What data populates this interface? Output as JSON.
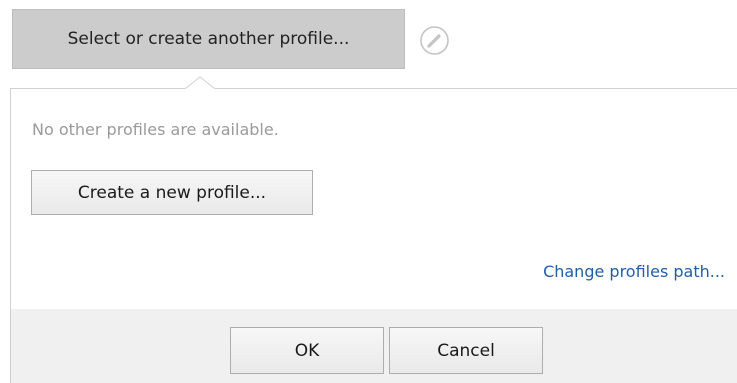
{
  "profile_selector": {
    "label": "Select or create another profile..."
  },
  "icons": {
    "edit": "pencil-icon"
  },
  "popup": {
    "empty_message": "No other profiles are available.",
    "create_button_label": "Create a new profile...",
    "change_path_link": "Change profiles path..."
  },
  "footer": {
    "ok_label": "OK",
    "cancel_label": "Cancel"
  },
  "colors": {
    "selector_bg": "#cccccc",
    "link": "#1f5fa8",
    "muted_text": "#9a9a9a",
    "footer_bg": "#f0f0f0"
  }
}
